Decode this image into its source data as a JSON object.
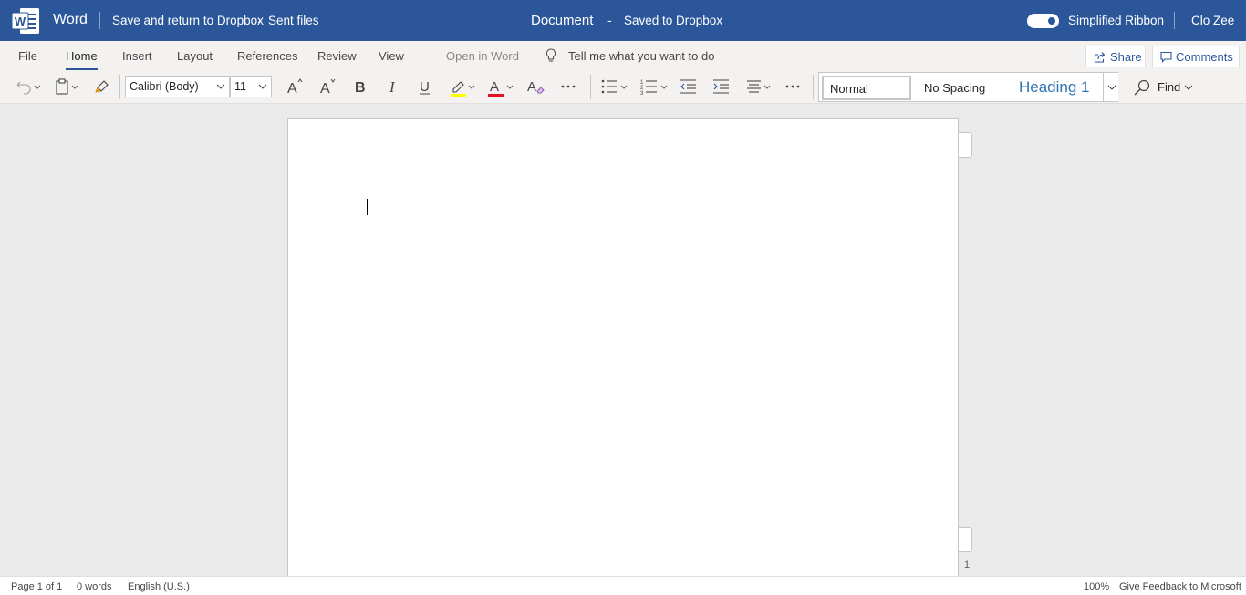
{
  "titlebar": {
    "app_name": "Word",
    "breadcrumb_save": "Save and return to Dropbox",
    "breadcrumb_folder": "Sent files",
    "doc_title": "Document",
    "doc_separator": "-",
    "save_status": "Saved to Dropbox",
    "simplified_ribbon_label": "Simplified Ribbon",
    "simplified_ribbon_on": true,
    "user_name": "Clo Zee"
  },
  "tabs": [
    {
      "label": "File"
    },
    {
      "label": "Home",
      "active": true
    },
    {
      "label": "Insert"
    },
    {
      "label": "Layout"
    },
    {
      "label": "References"
    },
    {
      "label": "Review"
    },
    {
      "label": "View"
    }
  ],
  "open_in_word": "Open in Word",
  "tell_me": "Tell me what you want to do",
  "share_label": "Share",
  "comments_label": "Comments",
  "ribbon": {
    "font_name": "Calibri (Body)",
    "font_size": "11",
    "styles": {
      "normal": "Normal",
      "no_spacing": "No Spacing",
      "heading1": "Heading 1"
    },
    "find_label": "Find",
    "highlight_color": "#ffff00",
    "font_color": "#e81123"
  },
  "document": {
    "page_number": "1"
  },
  "status": {
    "page": "Page 1 of 1",
    "words": "0 words",
    "language": "English (U.S.)",
    "zoom": "100%",
    "feedback": "Give Feedback to Microsoft"
  },
  "colors": {
    "brand": "#2b579a",
    "heading_blue": "#2e74b5"
  }
}
